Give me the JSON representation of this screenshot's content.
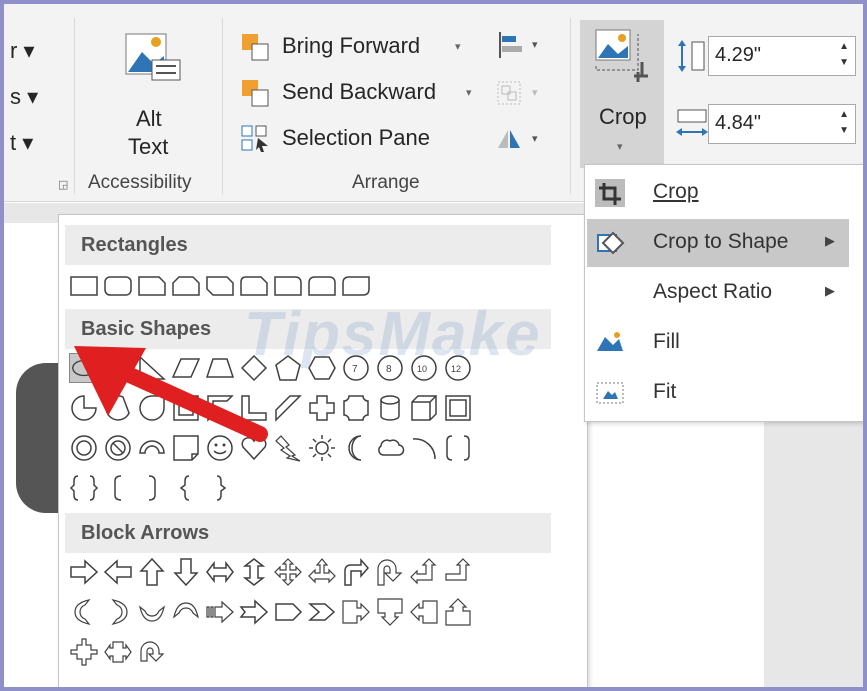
{
  "ribbon": {
    "partial_left": [
      "r ▾",
      "s ▾",
      "t ▾"
    ],
    "alt_text": {
      "line1": "Alt",
      "line2": "Text"
    },
    "accessibility_label": "Accessibility",
    "bring_forward": "Bring Forward",
    "send_backward": "Send Backward",
    "selection_pane": "Selection Pane",
    "arrange_label": "Arrange",
    "crop_label": "Crop",
    "height_value": "4.29\"",
    "width_value": "4.84\""
  },
  "gallery": {
    "categories": {
      "rectangles": "Rectangles",
      "basic_shapes": "Basic Shapes",
      "block_arrows": "Block Arrows"
    }
  },
  "crop_menu": {
    "items": [
      {
        "label": "Crop",
        "icon": "crop-icon"
      },
      {
        "label": "Crop to Shape",
        "icon": "crop-to-shape-icon"
      },
      {
        "label": "Aspect Ratio",
        "icon": ""
      },
      {
        "label": "Fill",
        "icon": "fill-icon"
      },
      {
        "label": "Fit",
        "icon": "fit-icon"
      }
    ]
  },
  "watermark": "TipsMake",
  "colors": {
    "frame": "#8f8fc9",
    "ribbon": "#f3f3f3",
    "highlight": "#c8c8c8",
    "arrow": "#e02020",
    "shape_stroke": "#404040"
  }
}
